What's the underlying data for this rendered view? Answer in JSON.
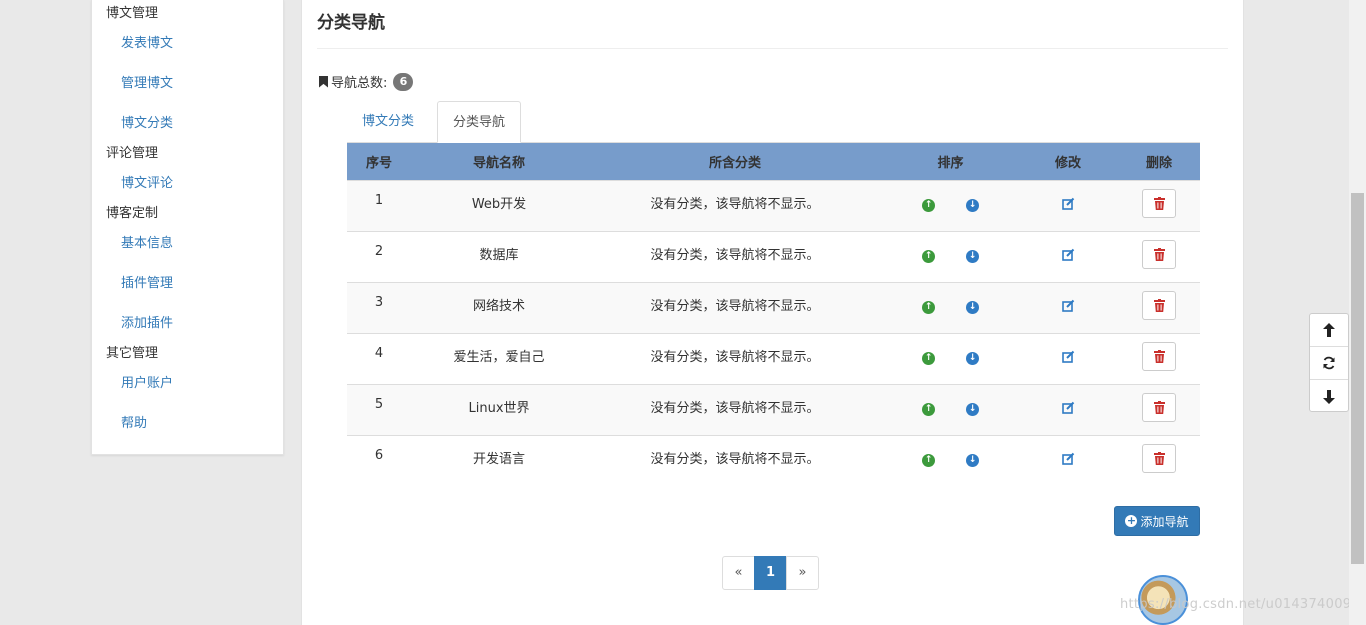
{
  "sidebar": {
    "groups": [
      {
        "label": "博文管理",
        "items": [
          "发表博文",
          "管理博文",
          "博文分类"
        ]
      },
      {
        "label": "评论管理",
        "items": [
          "博文评论"
        ]
      },
      {
        "label": "博客定制",
        "items": [
          "基本信息",
          "插件管理",
          "添加插件"
        ]
      },
      {
        "label": "其它管理",
        "items": [
          "用户账户",
          "帮助"
        ]
      }
    ]
  },
  "main": {
    "title": "分类导航",
    "count_label": "导航总数:",
    "count": "6",
    "tabs": [
      "博文分类",
      "分类导航"
    ],
    "active_tab": "分类导航",
    "table": {
      "headers": [
        "序号",
        "导航名称",
        "所含分类",
        "排序",
        "修改",
        "删除"
      ],
      "rows": [
        {
          "id": "1",
          "name": "Web开发",
          "categories": "没有分类，该导航将不显示。"
        },
        {
          "id": "2",
          "name": "数据库",
          "categories": "没有分类，该导航将不显示。"
        },
        {
          "id": "3",
          "name": "网络技术",
          "categories": "没有分类，该导航将不显示。"
        },
        {
          "id": "4",
          "name": "爱生活，爱自己",
          "categories": "没有分类，该导航将不显示。"
        },
        {
          "id": "5",
          "name": "Linux世界",
          "categories": "没有分类，该导航将不显示。"
        },
        {
          "id": "6",
          "name": "开发语言",
          "categories": "没有分类，该导航将不显示。"
        }
      ]
    },
    "add_button": "添加导航",
    "pagination": {
      "prev": "«",
      "current": "1",
      "next": "»"
    }
  },
  "watermark": "https://blog.csdn.net/u014374009",
  "colors": {
    "accent": "#337ab7",
    "table_header": "#779ccb",
    "up": "#3c9a3c",
    "down": "#2f7bc4",
    "delete": "#c9302c"
  }
}
